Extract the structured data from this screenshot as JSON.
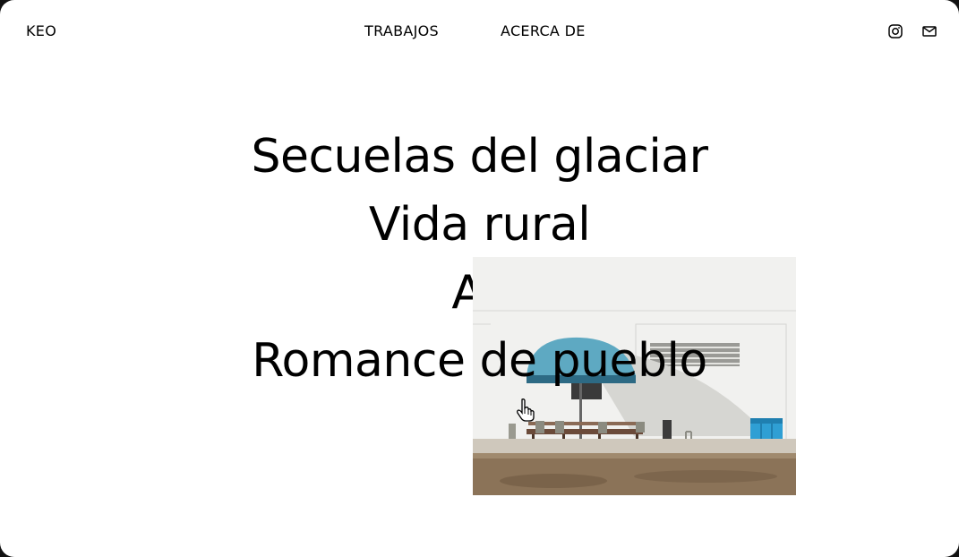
{
  "header": {
    "brand": "KEO",
    "nav": [
      {
        "label": "TRABAJOS"
      },
      {
        "label": "ACERCA DE"
      }
    ],
    "social": [
      {
        "icon": "instagram-icon"
      },
      {
        "icon": "mail-icon"
      }
    ]
  },
  "works": [
    {
      "title": "Secuelas del glaciar"
    },
    {
      "title": "Vida rural"
    },
    {
      "title": "Ac"
    },
    {
      "title": "Romance de pueblo"
    }
  ],
  "preview": {
    "description_icon": "photo-preview",
    "colors": {
      "wall": "#f1f1ef",
      "awning": "#5ea9c2",
      "ground": "#8b7358",
      "bins": "#2f9fd4"
    }
  }
}
